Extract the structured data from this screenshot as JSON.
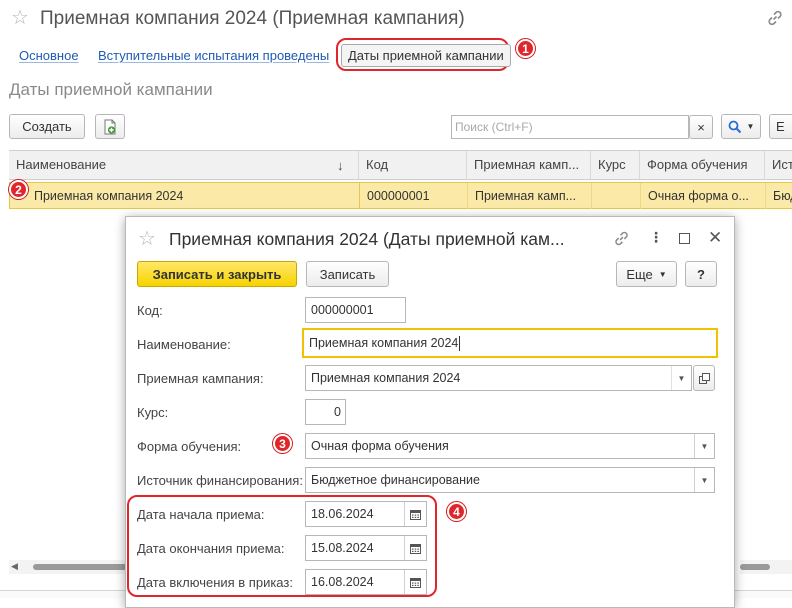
{
  "window": {
    "title": "Приемная компания 2024 (Приемная кампания)"
  },
  "nav": {
    "main": "Основное",
    "exams": "Вступительные испытания проведены",
    "dates": "Даты приемной кампании"
  },
  "section": {
    "title": "Даты приемной кампании"
  },
  "toolbar": {
    "create_label": "Создать",
    "search_placeholder": "Поиск (Ctrl+F)",
    "search_clear": "×",
    "more_label": "Е"
  },
  "table": {
    "columns": [
      "Наименование",
      "Код",
      "Приемная камп...",
      "Курс",
      "Форма обучения",
      "Ист"
    ],
    "sort_indicator": "↓",
    "rows": [
      {
        "name": "Приемная компания 2024",
        "code": "000000001",
        "campaign": "Приемная камп...",
        "course": "",
        "form": "Очная форма о...",
        "source": "Бюд"
      }
    ]
  },
  "badges": [
    "1",
    "2",
    "3",
    "4"
  ],
  "dialog": {
    "title": "Приемная компания 2024 (Даты приемной кам...",
    "save_close": "Записать и закрыть",
    "save": "Записать",
    "more": "Еще",
    "help": "?",
    "fields": {
      "code_label": "Код:",
      "code_value": "000000001",
      "name_label": "Наименование:",
      "name_value": "Приемная компания 2024",
      "campaign_label": "Приемная кампания:",
      "campaign_value": "Приемная компания 2024",
      "course_label": "Курс:",
      "course_value": "0",
      "form_label": "Форма обучения:",
      "form_value": "Очная форма обучения",
      "source_label": "Источник финансирования:",
      "source_value": "Бюджетное финансирование",
      "start_label": "Дата начала приема:",
      "start_value": "18.06.2024",
      "end_label": "Дата окончания приема:",
      "end_value": "15.08.2024",
      "order_label": "Дата включения в приказ:",
      "order_value": "16.08.2024"
    }
  },
  "colors": {
    "accent_red": "#e0262a",
    "link_blue": "#1f5bb3",
    "selection_yellow": "#fbeaa7",
    "primary_button": "#f7d300"
  }
}
